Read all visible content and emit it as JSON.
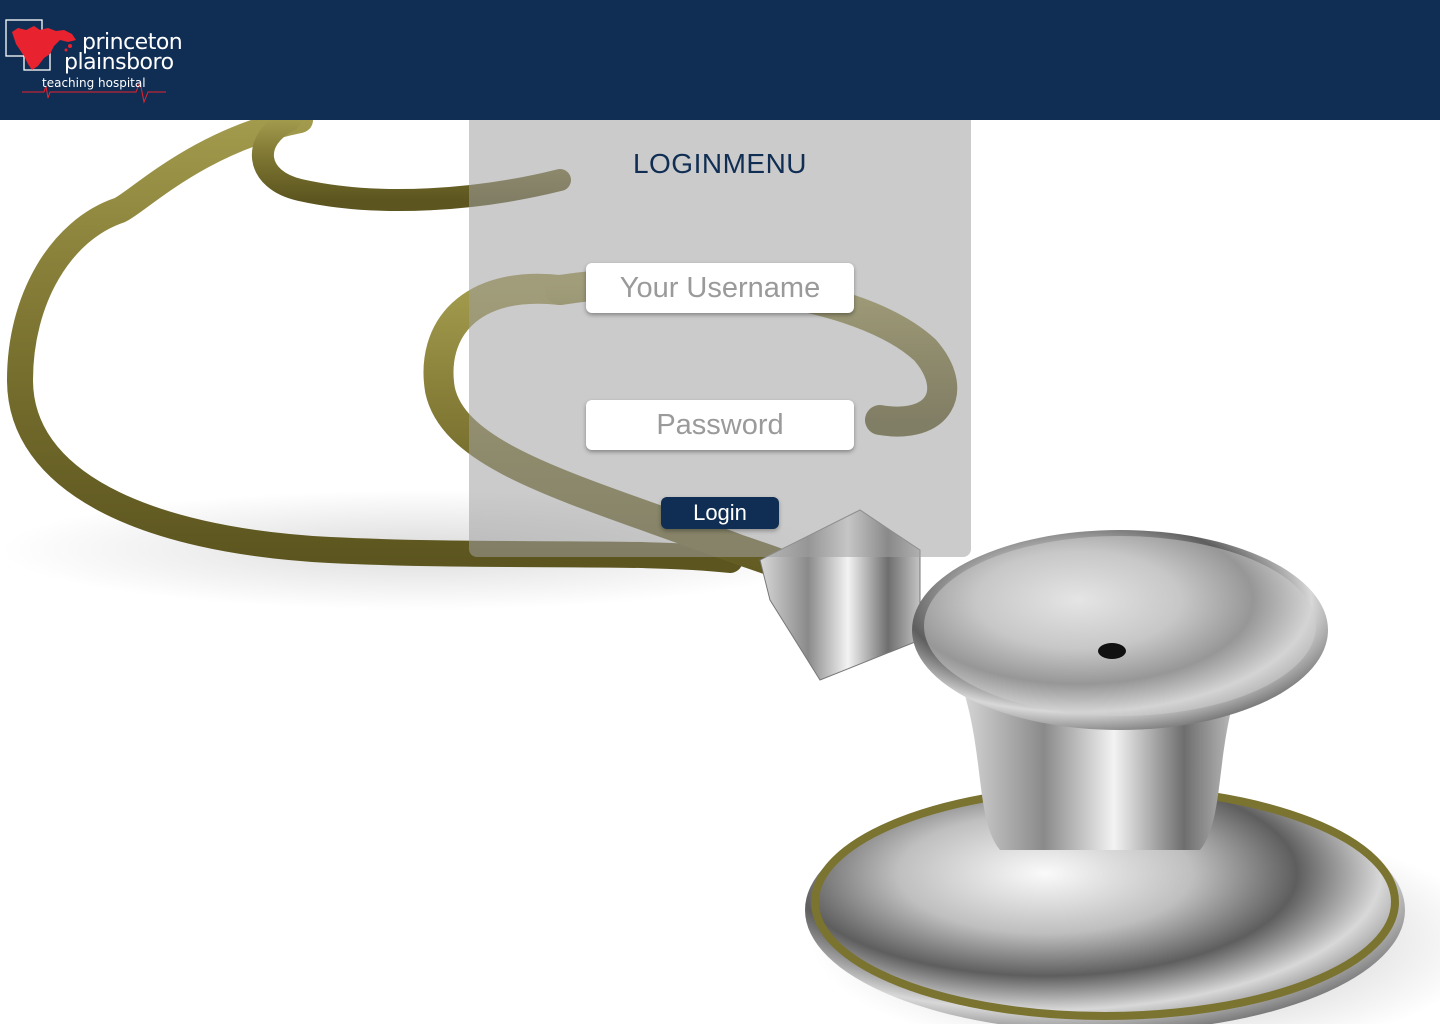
{
  "header": {
    "logo": {
      "line1": "princeton",
      "line2": "plainsboro",
      "line3": "teaching hospital"
    }
  },
  "login": {
    "title": "LOGINMENU",
    "username": {
      "placeholder": "Your Username",
      "value": ""
    },
    "password": {
      "placeholder": "Password",
      "value": ""
    },
    "submit_label": "Login"
  },
  "colors": {
    "header_bg": "#102e54",
    "accent": "#102e54",
    "logo_red": "#e8222e",
    "panel": "rgba(160,160,160,0.55)"
  },
  "icons": {
    "logo_mark": "hospital-logo-icon",
    "background": "stethoscope-image"
  }
}
